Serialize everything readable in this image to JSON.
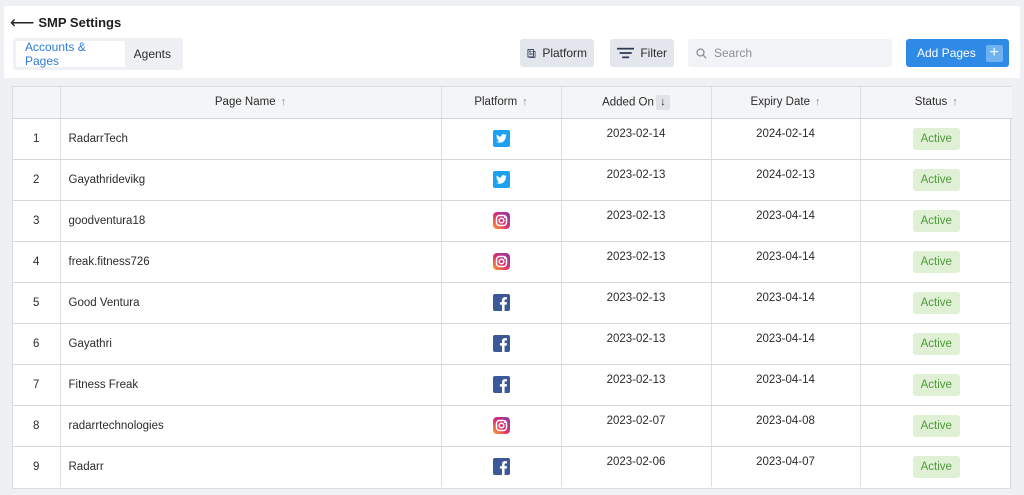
{
  "header": {
    "back_arrow": "⟵",
    "title": "SMP Settings"
  },
  "tabs": [
    {
      "label": "Accounts & Pages",
      "active": true
    },
    {
      "label": "Agents",
      "active": false
    }
  ],
  "toolbar": {
    "platform_label": "Platform",
    "filter_label": "Filter",
    "search_placeholder": "Search",
    "add_label": "Add Pages",
    "add_symbol": "+"
  },
  "table": {
    "columns": {
      "page_name": "Page Name",
      "platform": "Platform",
      "added_on": "Added On",
      "expiry_date": "Expiry Date",
      "status": "Status"
    },
    "sort_up": "↑",
    "sort_down": "↓",
    "rows": [
      {
        "index": "1",
        "name": "RadarrTech",
        "platform": "twitter",
        "added": "2023-02-14",
        "expiry": "2024-02-14",
        "status": "Active"
      },
      {
        "index": "2",
        "name": "Gayathridevikg",
        "platform": "twitter",
        "added": "2023-02-13",
        "expiry": "2024-02-13",
        "status": "Active"
      },
      {
        "index": "3",
        "name": "goodventura18",
        "platform": "instagram",
        "added": "2023-02-13",
        "expiry": "2023-04-14",
        "status": "Active"
      },
      {
        "index": "4",
        "name": "freak.fitness726",
        "platform": "instagram",
        "added": "2023-02-13",
        "expiry": "2023-04-14",
        "status": "Active"
      },
      {
        "index": "5",
        "name": "Good Ventura",
        "platform": "facebook",
        "added": "2023-02-13",
        "expiry": "2023-04-14",
        "status": "Active"
      },
      {
        "index": "6",
        "name": "Gayathri",
        "platform": "facebook",
        "added": "2023-02-13",
        "expiry": "2023-04-14",
        "status": "Active"
      },
      {
        "index": "7",
        "name": "Fitness Freak",
        "platform": "facebook",
        "added": "2023-02-13",
        "expiry": "2023-04-14",
        "status": "Active"
      },
      {
        "index": "8",
        "name": "radarrtechnologies",
        "platform": "instagram",
        "added": "2023-02-07",
        "expiry": "2023-04-08",
        "status": "Active"
      },
      {
        "index": "9",
        "name": "Radarr",
        "platform": "facebook",
        "added": "2023-02-06",
        "expiry": "2023-04-07",
        "status": "Active"
      }
    ]
  },
  "colors": {
    "accent": "#2f8ae6",
    "active_badge_bg": "#dff0d5",
    "active_badge_text": "#4f9a3a",
    "twitter": "#1da1f2",
    "facebook": "#3b5998"
  }
}
